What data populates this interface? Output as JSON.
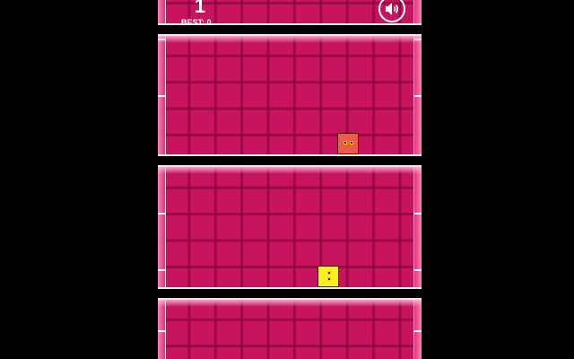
{
  "hud": {
    "score": "1",
    "best_label": "BEST: 0"
  },
  "icons": {
    "sound": "speaker-icon"
  },
  "colors": {
    "background": "#000000",
    "playfield": "#c8135e",
    "grid_line": "#78003280",
    "floor": "#000000",
    "floor_edge": "#e8e8e8",
    "enemy_cube": "#f05a4a",
    "player_cube": "#f8ee20"
  },
  "game": {
    "lanes": 3,
    "player_lane": 2,
    "enemy_lane": 1
  }
}
